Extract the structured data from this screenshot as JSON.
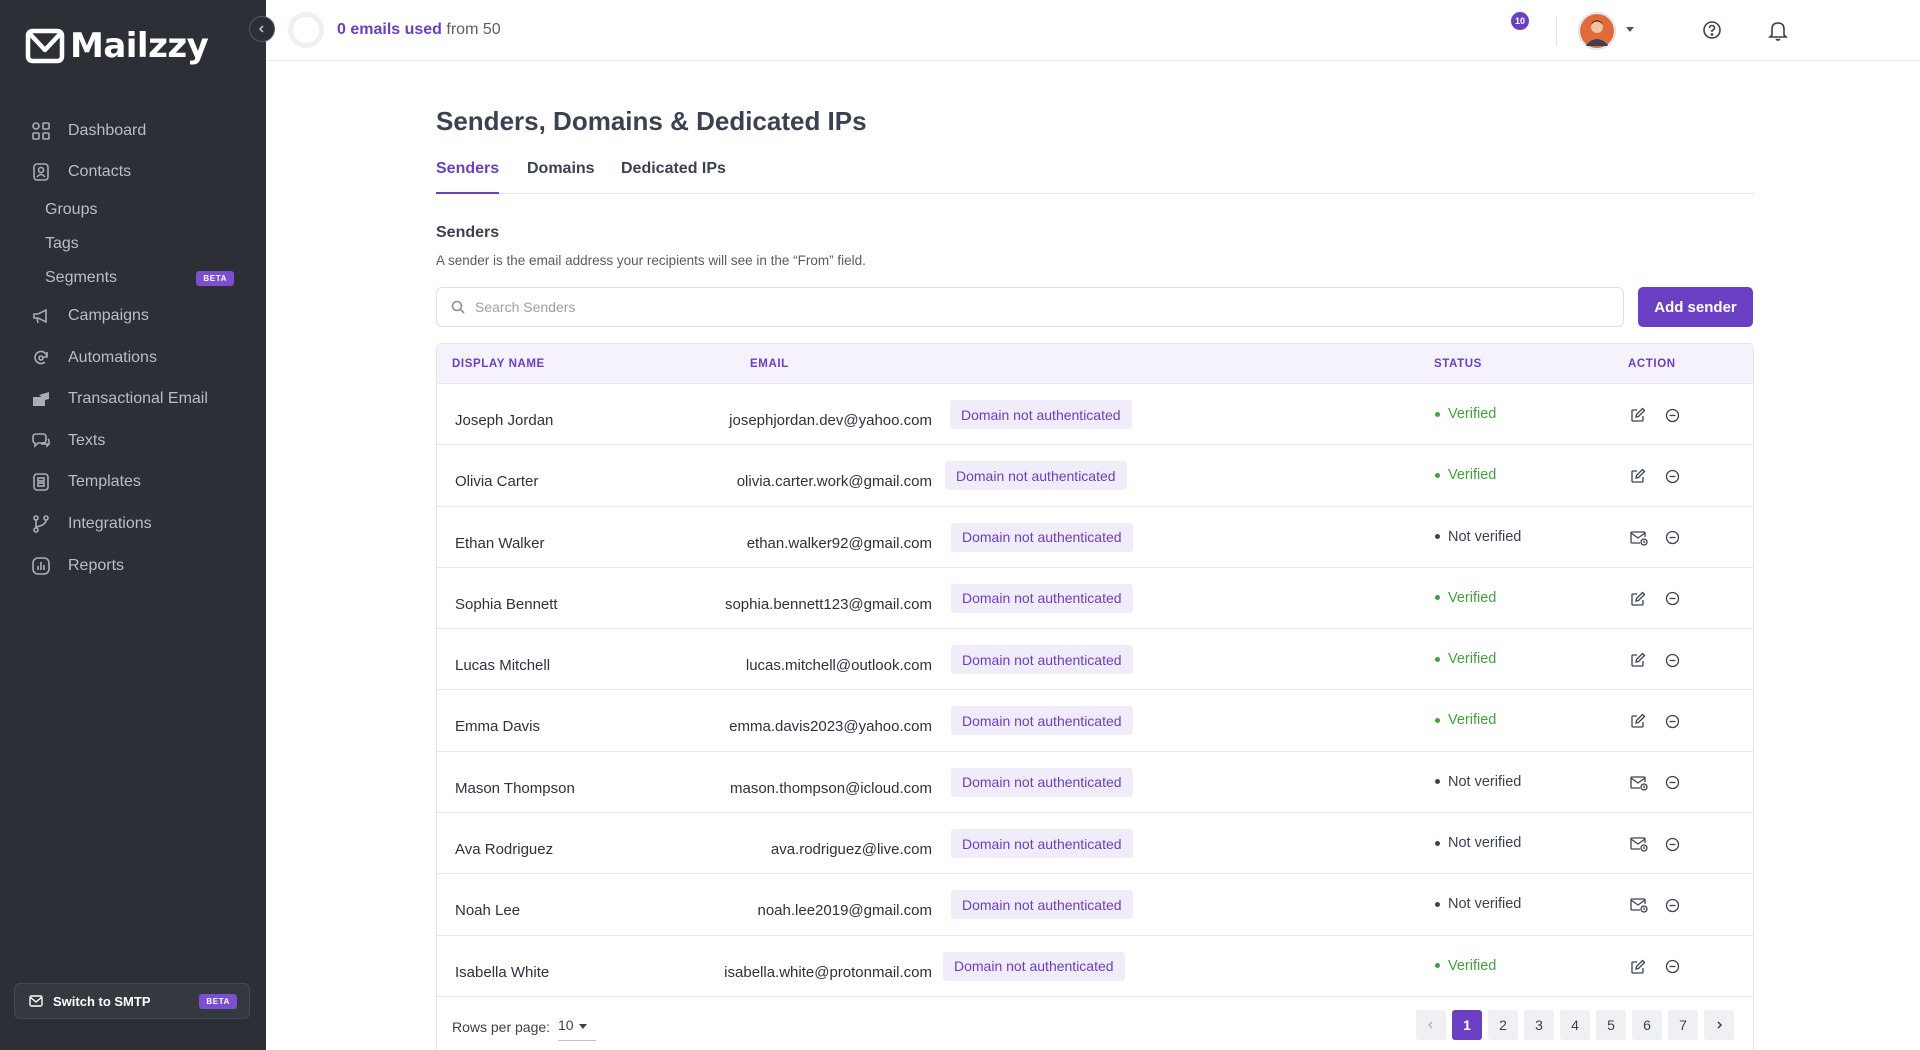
{
  "brand": {
    "name": "Mailzzy"
  },
  "topbar": {
    "usage_used": "0 emails used",
    "usage_rest": " from 50",
    "notification_count": "10"
  },
  "sidebar": {
    "items": [
      {
        "label": "Dashboard",
        "icon": "dashboard-icon"
      },
      {
        "label": "Contacts",
        "icon": "contacts-icon"
      },
      {
        "label": "Campaigns",
        "icon": "megaphone-icon"
      },
      {
        "label": "Automations",
        "icon": "automation-icon"
      },
      {
        "label": "Transactional Email",
        "icon": "transactional-email-icon"
      },
      {
        "label": "Texts",
        "icon": "chat-icon"
      },
      {
        "label": "Templates",
        "icon": "template-icon"
      },
      {
        "label": "Integrations",
        "icon": "integration-icon"
      },
      {
        "label": "Reports",
        "icon": "reports-icon"
      }
    ],
    "contacts_sub": [
      {
        "label": "Groups"
      },
      {
        "label": "Tags"
      },
      {
        "label": "Segments",
        "badge": "BETA"
      }
    ],
    "smtp_label": "Switch to SMTP",
    "smtp_badge": "BETA"
  },
  "page": {
    "title": "Senders, Domains & Dedicated IPs",
    "tabs": [
      {
        "label": "Senders",
        "active": true
      },
      {
        "label": "Domains"
      },
      {
        "label": "Dedicated IPs"
      }
    ],
    "section_title": "Senders",
    "section_desc": "A sender is the email address your recipients will see in the “From” field.",
    "search_placeholder": "Search Senders",
    "add_button": "Add sender"
  },
  "table": {
    "columns": [
      "DISPLAY NAME",
      "EMAIL",
      "STATUS",
      "ACTION"
    ],
    "rows": [
      {
        "name": "Joseph Jordan",
        "email": "josephjordan.dev@yahoo.com",
        "badge": "Domain not authenticated",
        "status": "Verified"
      },
      {
        "name": "Olivia Carter",
        "email": "olivia.carter.work@gmail.com",
        "badge": "Domain not authenticated",
        "status": "Verified"
      },
      {
        "name": "Ethan Walker",
        "email": "ethan.walker92@gmail.com",
        "badge": "Domain not authenticated",
        "status": "Not verified"
      },
      {
        "name": "Sophia Bennett",
        "email": "sophia.bennett123@gmail.com",
        "badge": "Domain not authenticated",
        "status": "Verified"
      },
      {
        "name": "Lucas Mitchell",
        "email": "lucas.mitchell@outlook.com",
        "badge": "Domain not authenticated",
        "status": "Verified"
      },
      {
        "name": "Emma Davis",
        "email": "emma.davis2023@yahoo.com",
        "badge": "Domain not authenticated",
        "status": "Verified"
      },
      {
        "name": "Mason Thompson",
        "email": "mason.thompson@icloud.com",
        "badge": "Domain not authenticated",
        "status": "Not verified"
      },
      {
        "name": "Ava Rodriguez",
        "email": "ava.rodriguez@live.com",
        "badge": "Domain not authenticated",
        "status": "Not verified"
      },
      {
        "name": "Noah Lee",
        "email": "noah.lee2019@gmail.com",
        "badge": "Domain not authenticated",
        "status": "Not verified"
      },
      {
        "name": "Isabella White",
        "email": "isabella.white@protonmail.com",
        "badge": "Domain not authenticated",
        "status": "Verified"
      }
    ],
    "rows_per_page_label": "Rows per page:",
    "rows_per_page_value": "10",
    "pages": [
      "1",
      "2",
      "3",
      "4",
      "5",
      "6",
      "7"
    ],
    "current_page": "1"
  },
  "colors": {
    "accent": "#6a3fc4",
    "sidebar_bg": "#2c3036",
    "verified": "#3fa53a"
  }
}
